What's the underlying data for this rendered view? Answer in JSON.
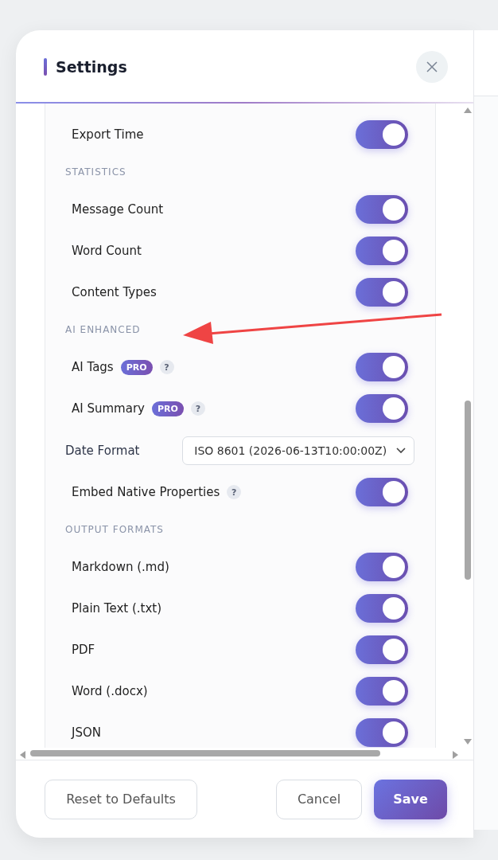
{
  "dialog": {
    "title": "Settings",
    "items": [
      {
        "kind": "toggle",
        "label": "Export Time",
        "on": true
      },
      {
        "kind": "section",
        "label": "STATISTICS"
      },
      {
        "kind": "toggle",
        "label": "Message Count",
        "on": true
      },
      {
        "kind": "toggle",
        "label": "Word Count",
        "on": true
      },
      {
        "kind": "toggle",
        "label": "Content Types",
        "on": true
      },
      {
        "kind": "section",
        "label": "AI ENHANCED"
      },
      {
        "kind": "toggle",
        "label": "AI Tags",
        "badge": "PRO",
        "help": "?",
        "on": true
      },
      {
        "kind": "toggle",
        "label": "AI Summary",
        "badge": "PRO",
        "help": "?",
        "on": true
      },
      {
        "kind": "select",
        "label": "Date Format",
        "value": "ISO 8601 (2026-06-13T10:00:00Z)"
      },
      {
        "kind": "toggle",
        "label": "Embed Native Properties",
        "help": "?",
        "on": true
      },
      {
        "kind": "section",
        "label": "OUTPUT FORMATS"
      },
      {
        "kind": "toggle",
        "label": "Markdown (.md)",
        "on": true
      },
      {
        "kind": "toggle",
        "label": "Plain Text (.txt)",
        "on": true
      },
      {
        "kind": "toggle",
        "label": "PDF",
        "on": true
      },
      {
        "kind": "toggle",
        "label": "Word (.docx)",
        "on": true
      },
      {
        "kind": "toggle",
        "label": "JSON",
        "on": true
      }
    ],
    "footer": {
      "reset": "Reset to Defaults",
      "cancel": "Cancel",
      "save": "Save"
    }
  }
}
